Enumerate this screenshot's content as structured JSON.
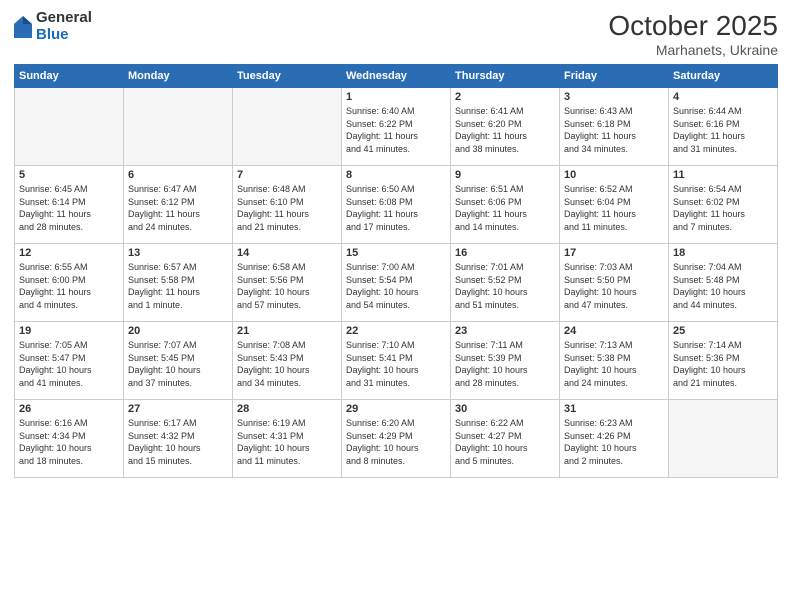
{
  "logo": {
    "general": "General",
    "blue": "Blue"
  },
  "title": "October 2025",
  "location": "Marhanets, Ukraine",
  "headers": [
    "Sunday",
    "Monday",
    "Tuesday",
    "Wednesday",
    "Thursday",
    "Friday",
    "Saturday"
  ],
  "weeks": [
    [
      {
        "day": "",
        "info": ""
      },
      {
        "day": "",
        "info": ""
      },
      {
        "day": "",
        "info": ""
      },
      {
        "day": "1",
        "info": "Sunrise: 6:40 AM\nSunset: 6:22 PM\nDaylight: 11 hours\nand 41 minutes."
      },
      {
        "day": "2",
        "info": "Sunrise: 6:41 AM\nSunset: 6:20 PM\nDaylight: 11 hours\nand 38 minutes."
      },
      {
        "day": "3",
        "info": "Sunrise: 6:43 AM\nSunset: 6:18 PM\nDaylight: 11 hours\nand 34 minutes."
      },
      {
        "day": "4",
        "info": "Sunrise: 6:44 AM\nSunset: 6:16 PM\nDaylight: 11 hours\nand 31 minutes."
      }
    ],
    [
      {
        "day": "5",
        "info": "Sunrise: 6:45 AM\nSunset: 6:14 PM\nDaylight: 11 hours\nand 28 minutes."
      },
      {
        "day": "6",
        "info": "Sunrise: 6:47 AM\nSunset: 6:12 PM\nDaylight: 11 hours\nand 24 minutes."
      },
      {
        "day": "7",
        "info": "Sunrise: 6:48 AM\nSunset: 6:10 PM\nDaylight: 11 hours\nand 21 minutes."
      },
      {
        "day": "8",
        "info": "Sunrise: 6:50 AM\nSunset: 6:08 PM\nDaylight: 11 hours\nand 17 minutes."
      },
      {
        "day": "9",
        "info": "Sunrise: 6:51 AM\nSunset: 6:06 PM\nDaylight: 11 hours\nand 14 minutes."
      },
      {
        "day": "10",
        "info": "Sunrise: 6:52 AM\nSunset: 6:04 PM\nDaylight: 11 hours\nand 11 minutes."
      },
      {
        "day": "11",
        "info": "Sunrise: 6:54 AM\nSunset: 6:02 PM\nDaylight: 11 hours\nand 7 minutes."
      }
    ],
    [
      {
        "day": "12",
        "info": "Sunrise: 6:55 AM\nSunset: 6:00 PM\nDaylight: 11 hours\nand 4 minutes."
      },
      {
        "day": "13",
        "info": "Sunrise: 6:57 AM\nSunset: 5:58 PM\nDaylight: 11 hours\nand 1 minute."
      },
      {
        "day": "14",
        "info": "Sunrise: 6:58 AM\nSunset: 5:56 PM\nDaylight: 10 hours\nand 57 minutes."
      },
      {
        "day": "15",
        "info": "Sunrise: 7:00 AM\nSunset: 5:54 PM\nDaylight: 10 hours\nand 54 minutes."
      },
      {
        "day": "16",
        "info": "Sunrise: 7:01 AM\nSunset: 5:52 PM\nDaylight: 10 hours\nand 51 minutes."
      },
      {
        "day": "17",
        "info": "Sunrise: 7:03 AM\nSunset: 5:50 PM\nDaylight: 10 hours\nand 47 minutes."
      },
      {
        "day": "18",
        "info": "Sunrise: 7:04 AM\nSunset: 5:48 PM\nDaylight: 10 hours\nand 44 minutes."
      }
    ],
    [
      {
        "day": "19",
        "info": "Sunrise: 7:05 AM\nSunset: 5:47 PM\nDaylight: 10 hours\nand 41 minutes."
      },
      {
        "day": "20",
        "info": "Sunrise: 7:07 AM\nSunset: 5:45 PM\nDaylight: 10 hours\nand 37 minutes."
      },
      {
        "day": "21",
        "info": "Sunrise: 7:08 AM\nSunset: 5:43 PM\nDaylight: 10 hours\nand 34 minutes."
      },
      {
        "day": "22",
        "info": "Sunrise: 7:10 AM\nSunset: 5:41 PM\nDaylight: 10 hours\nand 31 minutes."
      },
      {
        "day": "23",
        "info": "Sunrise: 7:11 AM\nSunset: 5:39 PM\nDaylight: 10 hours\nand 28 minutes."
      },
      {
        "day": "24",
        "info": "Sunrise: 7:13 AM\nSunset: 5:38 PM\nDaylight: 10 hours\nand 24 minutes."
      },
      {
        "day": "25",
        "info": "Sunrise: 7:14 AM\nSunset: 5:36 PM\nDaylight: 10 hours\nand 21 minutes."
      }
    ],
    [
      {
        "day": "26",
        "info": "Sunrise: 6:16 AM\nSunset: 4:34 PM\nDaylight: 10 hours\nand 18 minutes."
      },
      {
        "day": "27",
        "info": "Sunrise: 6:17 AM\nSunset: 4:32 PM\nDaylight: 10 hours\nand 15 minutes."
      },
      {
        "day": "28",
        "info": "Sunrise: 6:19 AM\nSunset: 4:31 PM\nDaylight: 10 hours\nand 11 minutes."
      },
      {
        "day": "29",
        "info": "Sunrise: 6:20 AM\nSunset: 4:29 PM\nDaylight: 10 hours\nand 8 minutes."
      },
      {
        "day": "30",
        "info": "Sunrise: 6:22 AM\nSunset: 4:27 PM\nDaylight: 10 hours\nand 5 minutes."
      },
      {
        "day": "31",
        "info": "Sunrise: 6:23 AM\nSunset: 4:26 PM\nDaylight: 10 hours\nand 2 minutes."
      },
      {
        "day": "",
        "info": ""
      }
    ]
  ]
}
